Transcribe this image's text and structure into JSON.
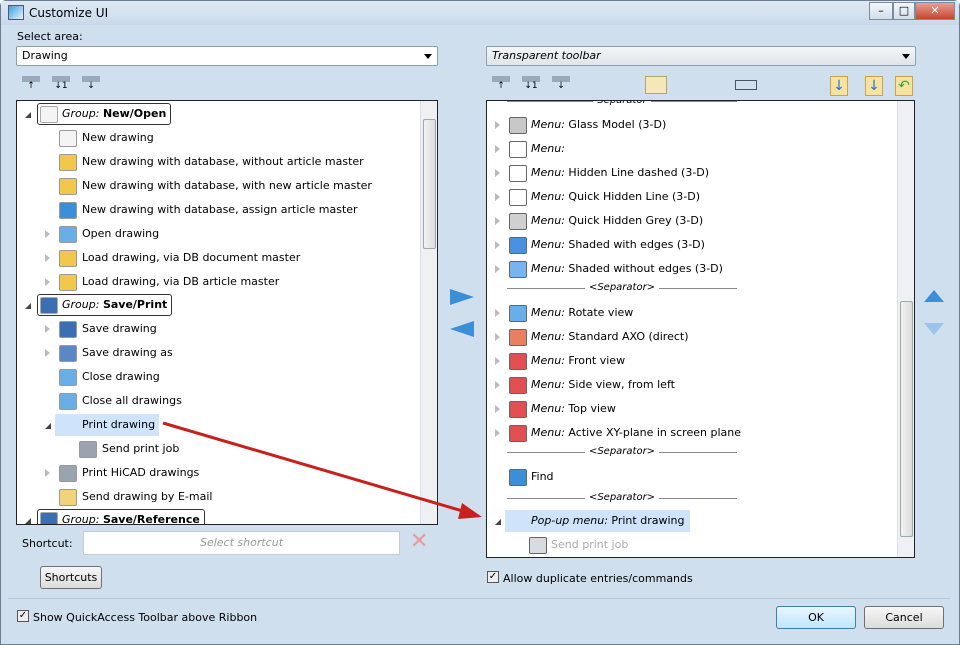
{
  "window": {
    "title": "Customize UI",
    "minimize": "–",
    "maximize": "□",
    "close": "✕"
  },
  "left": {
    "select_area_label": "Select area:",
    "area_value": "Drawing",
    "toolbar": [
      "collapse-all-icon",
      "expand-level-1-icon",
      "expand-all-icon"
    ],
    "rows": [
      {
        "type": "group",
        "prefix": "Group:",
        "label": "New/Open",
        "exp": "o",
        "level": 0,
        "icon": "document-icon",
        "color": "#f4f4f4"
      },
      {
        "type": "item",
        "label": "New drawing",
        "level": 1,
        "icon": "new-drawing-icon",
        "color": "#f4f4f4"
      },
      {
        "type": "item",
        "label": "New drawing with database, without article master",
        "level": 1,
        "icon": "database-drawing-icon",
        "color": "#f2c84b"
      },
      {
        "type": "item",
        "label": "New drawing with database, with new article master",
        "level": 1,
        "icon": "database-drawing-icon",
        "color": "#f2c84b"
      },
      {
        "type": "item",
        "label": "New drawing with database, assign article master",
        "level": 1,
        "icon": "database-drawing-icon",
        "color": "#3a8fd8"
      },
      {
        "type": "item",
        "label": "Open drawing",
        "exp": "c",
        "level": 1,
        "icon": "folder-open-icon",
        "color": "#6aaee8"
      },
      {
        "type": "item",
        "label": "Load drawing, via DB document master",
        "exp": "c",
        "level": 1,
        "icon": "database-load-icon",
        "color": "#f2c84b"
      },
      {
        "type": "item",
        "label": "Load drawing, via DB article master",
        "exp": "c",
        "level": 1,
        "icon": "database-load-icon",
        "color": "#f2c84b"
      },
      {
        "type": "group",
        "prefix": "Group:",
        "label": "Save/Print",
        "exp": "o",
        "level": 0,
        "icon": "save-icon",
        "color": "#3b6fb3"
      },
      {
        "type": "item",
        "label": "Save drawing",
        "exp": "c",
        "level": 1,
        "icon": "save-icon",
        "color": "#3b6fb3"
      },
      {
        "type": "item",
        "label": "Save drawing as",
        "exp": "c",
        "level": 1,
        "icon": "save-as-icon",
        "color": "#5a87c6"
      },
      {
        "type": "item",
        "label": "Close drawing",
        "level": 1,
        "icon": "close-drawing-icon",
        "color": "#6aaee8"
      },
      {
        "type": "item",
        "label": "Close all drawings",
        "level": 1,
        "icon": "close-all-icon",
        "color": "#6aaee8"
      },
      {
        "type": "item",
        "label": "Print drawing",
        "exp": "o",
        "level": 1,
        "icon": "printer-icon",
        "color": "#9aa4b0",
        "selected": true
      },
      {
        "type": "item",
        "label": "Send print job",
        "level": 2,
        "icon": "printer-icon",
        "color": "#9aa4b0"
      },
      {
        "type": "item",
        "label": "Print HiCAD drawings",
        "exp": "c",
        "level": 1,
        "icon": "printer-icon",
        "color": "#9aa4b0"
      },
      {
        "type": "item",
        "label": "Send drawing by E-mail",
        "level": 1,
        "icon": "email-icon",
        "color": "#f2d27a"
      },
      {
        "type": "group",
        "prefix": "Group:",
        "label": "Save/Reference",
        "exp": "o",
        "level": 0,
        "icon": "gear-icon",
        "color": "#3b6fb3"
      }
    ],
    "shortcut_label": "Shortcut:",
    "shortcut_placeholder": "Select shortcut",
    "shortcuts_button": "Shortcuts"
  },
  "right": {
    "toolbar_value": "Transparent toolbar",
    "toolbar": [
      "collapse-all-icon",
      "expand-level-1-icon",
      "expand-all-icon",
      "folder-icon",
      "separator-icon",
      "import-icon",
      "load-icon",
      "undo-icon"
    ],
    "rows": [
      {
        "type": "sep",
        "label": "Separator"
      },
      {
        "type": "item",
        "prefix": "Menu:",
        "label": "Glass Model (3-D)",
        "exp": "c",
        "icon": "cube-glass-icon",
        "color": "#c8c8c8"
      },
      {
        "type": "item",
        "prefix": "Menu:",
        "label": "",
        "exp": "c",
        "icon": "cube-wire-icon",
        "color": "#ffffff"
      },
      {
        "type": "item",
        "prefix": "Menu:",
        "label": "Hidden Line dashed (3-D)",
        "exp": "c",
        "icon": "cube-dashed-icon",
        "color": "#ffffff"
      },
      {
        "type": "item",
        "prefix": "Menu:",
        "label": "Quick Hidden Line (3-D)",
        "exp": "c",
        "icon": "cube-q-icon",
        "color": "#ffffff"
      },
      {
        "type": "item",
        "prefix": "Menu:",
        "label": "Quick Hidden Grey (3-D)",
        "exp": "c",
        "icon": "cube-q-grey-icon",
        "color": "#d0d0d0"
      },
      {
        "type": "item",
        "prefix": "Menu:",
        "label": "Shaded with edges (3-D)",
        "exp": "c",
        "icon": "cube-shaded-edges-icon",
        "color": "#4a90e0"
      },
      {
        "type": "item",
        "prefix": "Menu:",
        "label": "Shaded without edges (3-D)",
        "exp": "c",
        "icon": "cube-shaded-icon",
        "color": "#7ab4f0"
      },
      {
        "type": "sep",
        "label": "<Separator>"
      },
      {
        "type": "item",
        "prefix": "Menu:",
        "label": "Rotate view",
        "exp": "c",
        "icon": "rotate-view-icon",
        "color": "#6aaee8"
      },
      {
        "type": "item",
        "prefix": "Menu:",
        "label": "Standard AXO (direct)",
        "exp": "c",
        "icon": "axo-cube-icon",
        "color": "#e88060"
      },
      {
        "type": "item",
        "prefix": "Menu:",
        "label": "Front view",
        "exp": "c",
        "icon": "front-view-icon",
        "color": "#e05050"
      },
      {
        "type": "item",
        "prefix": "Menu:",
        "label": "Side view, from left",
        "exp": "c",
        "icon": "side-view-icon",
        "color": "#e05050"
      },
      {
        "type": "item",
        "prefix": "Menu:",
        "label": "Top view",
        "exp": "c",
        "icon": "top-view-icon",
        "color": "#e05050"
      },
      {
        "type": "item",
        "prefix": "Menu:",
        "label": "Active XY-plane in screen plane",
        "exp": "c",
        "icon": "xy-plane-icon",
        "color": "#e05050"
      },
      {
        "type": "sep",
        "label": "<Separator>"
      },
      {
        "type": "item",
        "prefix": "",
        "label": "Find",
        "icon": "filter-icon",
        "color": "#3a8fd8"
      },
      {
        "type": "sep",
        "label": "<Separator>"
      },
      {
        "type": "item",
        "prefix": "Pop-up menu:",
        "label": "Print drawing",
        "exp": "o",
        "icon": "printer-icon",
        "color": "#9aa4b0",
        "selected": true
      },
      {
        "type": "item",
        "prefix": "",
        "label": "Send print job",
        "icon": "printer-icon",
        "color": "#d8dce0",
        "disabled": true
      }
    ],
    "allow_duplicates_label": "Allow duplicate entries/commands",
    "allow_duplicates_checked": true
  },
  "footer": {
    "quickaccess_label": "Show QuickAccess Toolbar above Ribbon",
    "quickaccess_checked": true,
    "ok": "OK",
    "cancel": "Cancel"
  },
  "colors": {
    "arrow": "#c8201c",
    "accent": "#3a8fd8"
  }
}
